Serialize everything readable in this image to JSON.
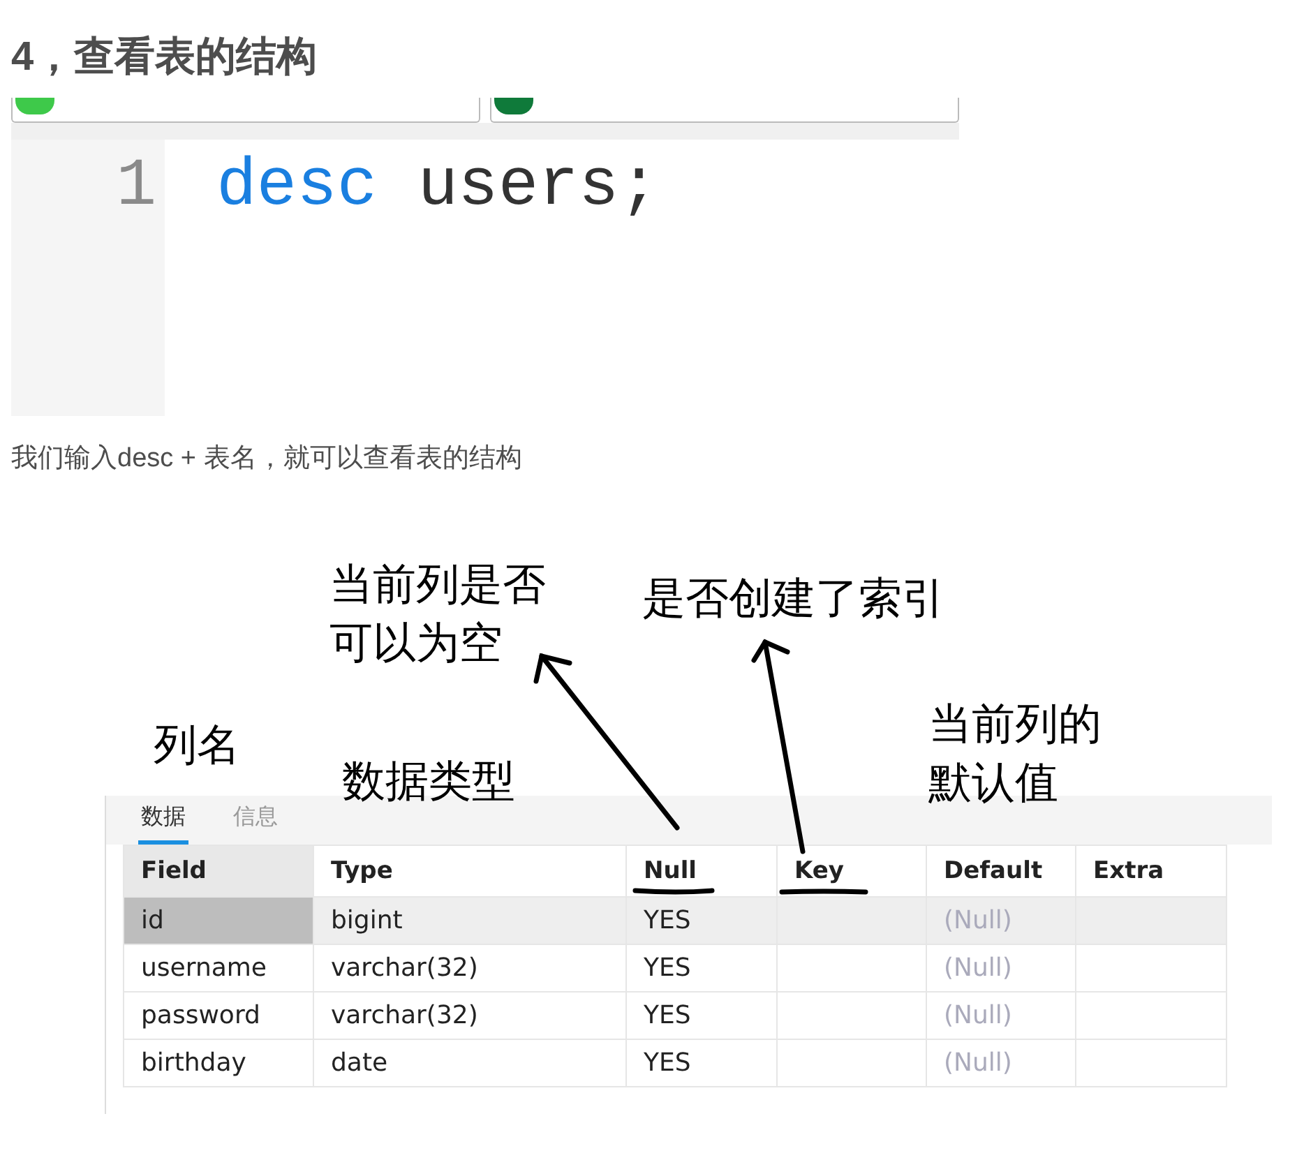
{
  "heading": "4，查看表的结构",
  "editor": {
    "lines": [
      {
        "number": "1",
        "tokens": [
          {
            "text": "desc",
            "kind": "keyword"
          },
          {
            "text": "users;",
            "kind": "plain"
          }
        ]
      }
    ]
  },
  "paragraph": "我们输入desc + 表名，就可以查看表的结构",
  "figure": {
    "annotations": [
      {
        "text": "当前列是否",
        "kind": "null-note"
      },
      {
        "text": "可以为空",
        "kind": "null-note-2"
      },
      {
        "text": "是否创建了索引",
        "kind": "key-note"
      },
      {
        "text": "列名",
        "kind": "field-note"
      },
      {
        "text": "数据类型",
        "kind": "type-note"
      },
      {
        "text": "当前列的",
        "kind": "default-note"
      },
      {
        "text": "默认值",
        "kind": "default-note-2"
      }
    ],
    "tabs": [
      {
        "label": "数据",
        "selected": true
      },
      {
        "label": "信息",
        "selected": false
      }
    ],
    "table": {
      "columns": [
        "Field",
        "Type",
        "Null",
        "Key",
        "Default",
        "Extra"
      ],
      "rows": [
        {
          "selected": true,
          "field": "id",
          "type": "bigint",
          "null": "YES",
          "default": "(Null)"
        },
        {
          "selected": false,
          "field": "username",
          "type": "varchar(32)",
          "null": "YES",
          "default": "(Null)"
        },
        {
          "selected": false,
          "field": "password",
          "type": "varchar(32)",
          "null": "YES",
          "default": "(Null)"
        },
        {
          "selected": false,
          "field": "birthday",
          "type": "date",
          "null": "YES",
          "default": "(Null)"
        }
      ]
    }
  }
}
